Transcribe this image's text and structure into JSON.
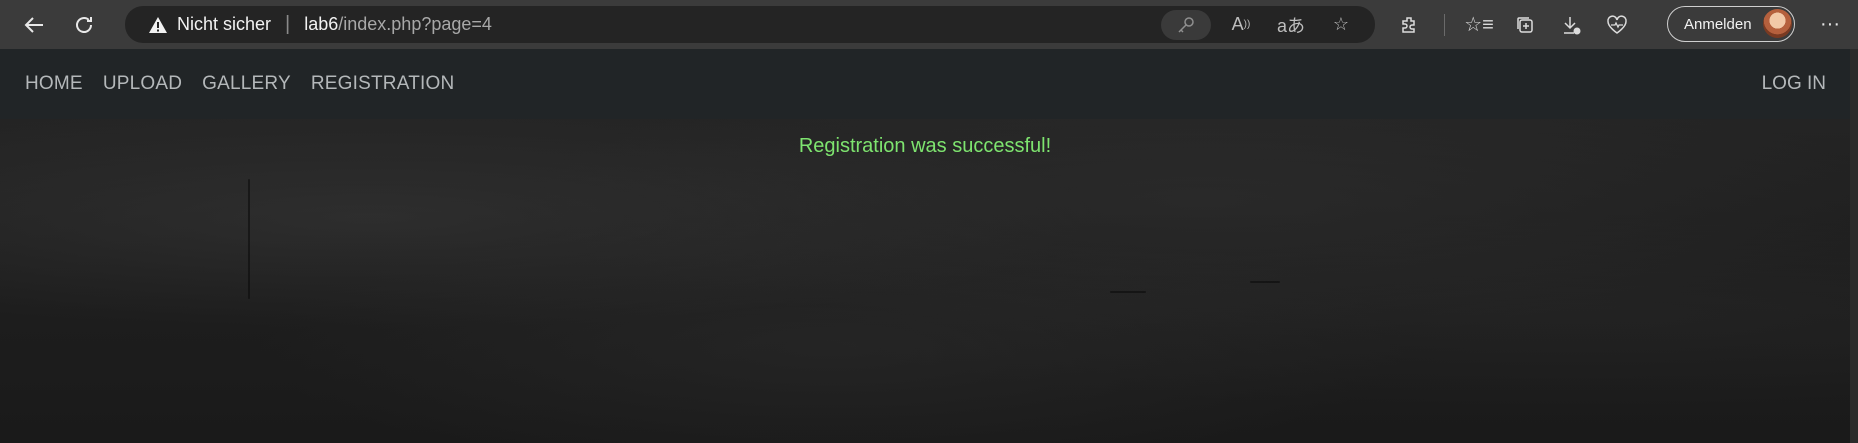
{
  "browser": {
    "security_label": "Nicht sicher",
    "url_host": "lab6",
    "url_path": "/index.php?page=4",
    "signin_label": "Anmelden",
    "icons": [
      "back-icon",
      "reload-icon",
      "warning-icon",
      "key-icon",
      "read-aloud-icon",
      "translate-icon",
      "favorite-star-icon",
      "extensions-icon",
      "favorites-icon",
      "collections-icon",
      "downloads-icon",
      "health-icon",
      "more-icon"
    ]
  },
  "site": {
    "nav": {
      "items": [
        {
          "label": "HOME"
        },
        {
          "label": "UPLOAD"
        },
        {
          "label": "GALLERY"
        },
        {
          "label": "REGISTRATION"
        }
      ],
      "login_label": "LOG IN"
    },
    "message": "Registration was successful!",
    "message_color": "#7ee46f"
  }
}
